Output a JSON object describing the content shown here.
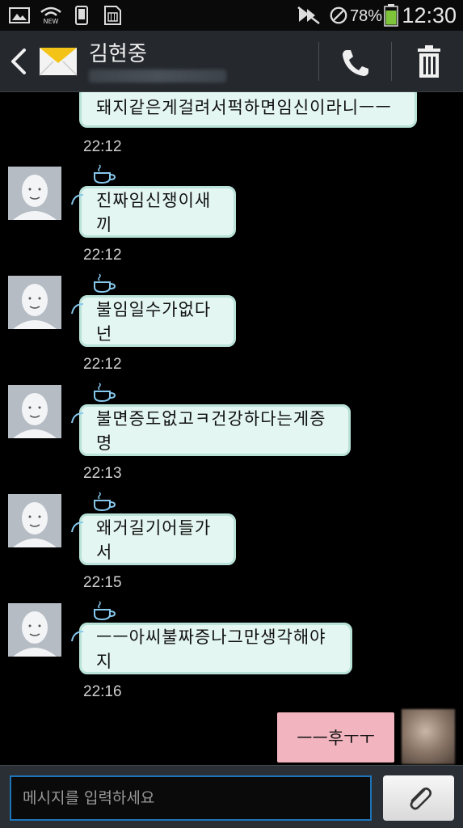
{
  "status_bar": {
    "battery_percent": "78%",
    "time": "12:30",
    "icons": [
      "gallery-icon",
      "wifi-new-icon",
      "phone-icon",
      "sim-icon",
      "mute-icon",
      "block-icon",
      "battery-icon"
    ]
  },
  "header": {
    "contact_name": "김현중",
    "icons": [
      "back-icon",
      "message-envelope-icon",
      "call-icon",
      "trash-icon"
    ]
  },
  "messages": [
    {
      "text": "돼지같은게걸려서퍽하면임신이라니ㅡㅡ",
      "time": "22:12"
    },
    {
      "text": "진짜임신쟁이새끼",
      "time": "22:12"
    },
    {
      "text": "불임일수가없다넌",
      "time": "22:12"
    },
    {
      "text": "불면증도없고ㅋ건강하다는게증명",
      "time": "22:13"
    },
    {
      "text": "왜거길기어들가서",
      "time": "22:15"
    },
    {
      "text": "ㅡㅡ아씨불짜증나그만생각해야지",
      "time": "22:16"
    }
  ],
  "sent_message": {
    "text": "ㅡㅡ후ㅜㅜ"
  },
  "composer": {
    "placeholder": "메시지를 입력하세요",
    "attach_icon": "paperclip-icon"
  },
  "colors": {
    "received_bubble": "#e3f6f1",
    "sent_bubble": "#f2b5bf",
    "action_bar": "#25292e",
    "input_border": "#1e74b8"
  }
}
